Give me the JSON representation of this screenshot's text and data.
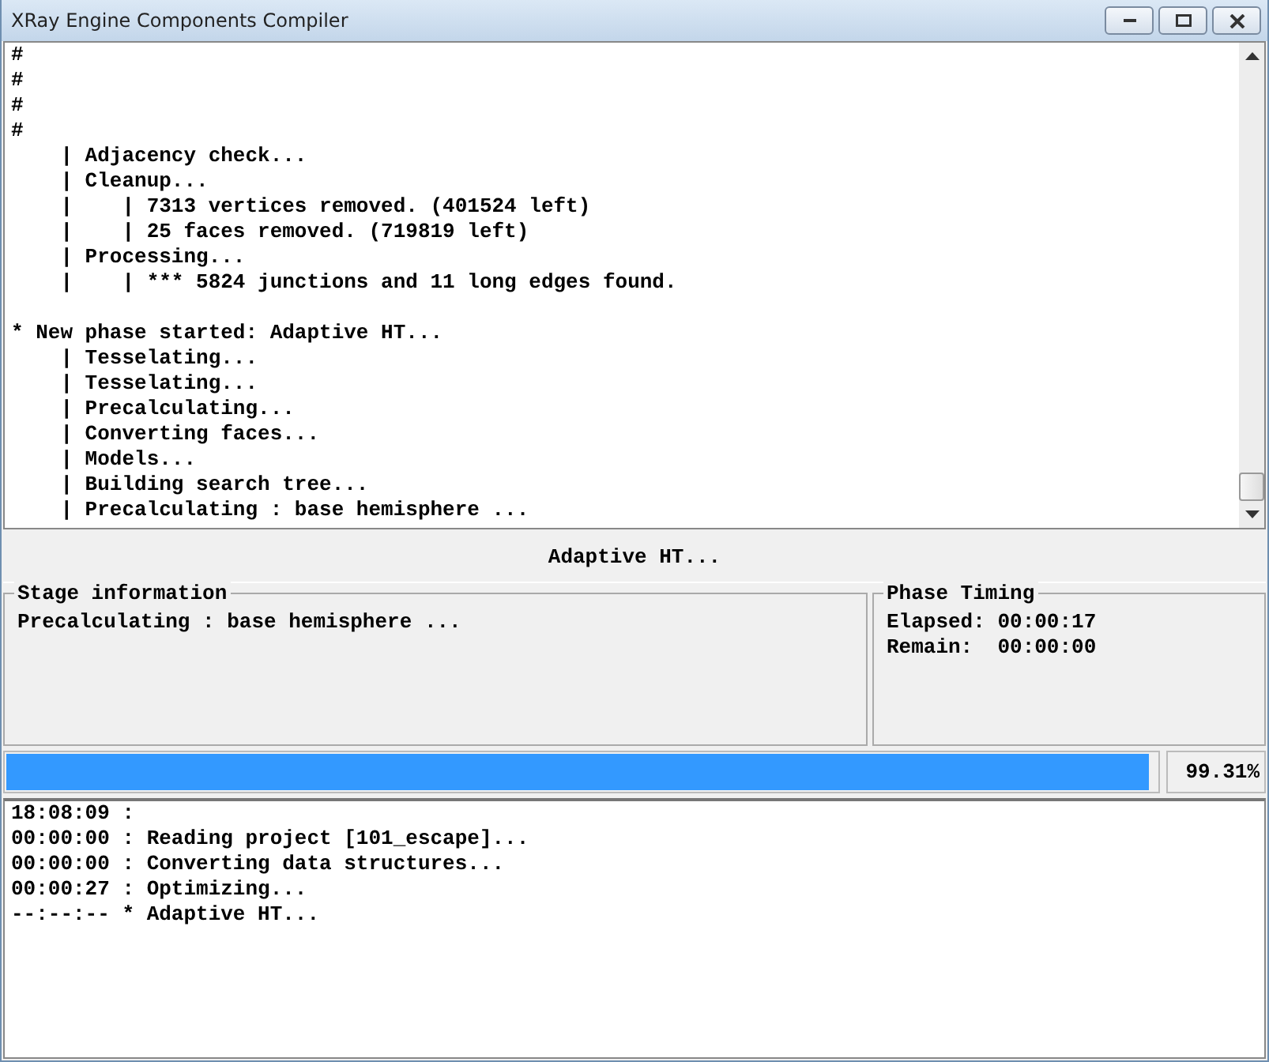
{
  "window": {
    "title": "XRay Engine Components Compiler",
    "buttons": [
      {
        "kind": "minimize"
      },
      {
        "kind": "maximize"
      },
      {
        "kind": "close"
      }
    ]
  },
  "log": {
    "blocks": [
      {
        "lines": [
          "#",
          "#",
          "#",
          "#",
          "    | Adjacency check...",
          "    | Cleanup...",
          "    |    | 7313 vertices removed. (401524 left)",
          "    |    | 25 faces removed. (719819 left)",
          "    | Processing...",
          "    |    | *** 5824 junctions and 11 long edges found."
        ]
      },
      {
        "lines": [
          "* New phase started: Adaptive HT...",
          "    | Tesselating...",
          "    | Tesselating...",
          "    | Precalculating...",
          "    | Converting faces...",
          "    | Models...",
          "    | Building search tree...",
          "    | Precalculating : base hemisphere ..."
        ]
      }
    ]
  },
  "phase": "Adaptive HT...",
  "stage_information": {
    "title": "Stage information",
    "text": "Precalculating : base hemisphere ..."
  },
  "phase_timing": {
    "title": "Phase Timing",
    "lines": [
      "Elapsed: 00:00:17",
      "Remain:  00:00:00"
    ]
  },
  "progress": {
    "level": 0.9931,
    "reading": "99.31%"
  },
  "history": {
    "lines": [
      "18:08:09 :",
      "00:00:00 : Reading project [101_escape]...",
      "00:00:00 : Converting data structures...",
      "00:00:27 : Optimizing...",
      "--:--:-- * Adaptive HT..."
    ]
  }
}
